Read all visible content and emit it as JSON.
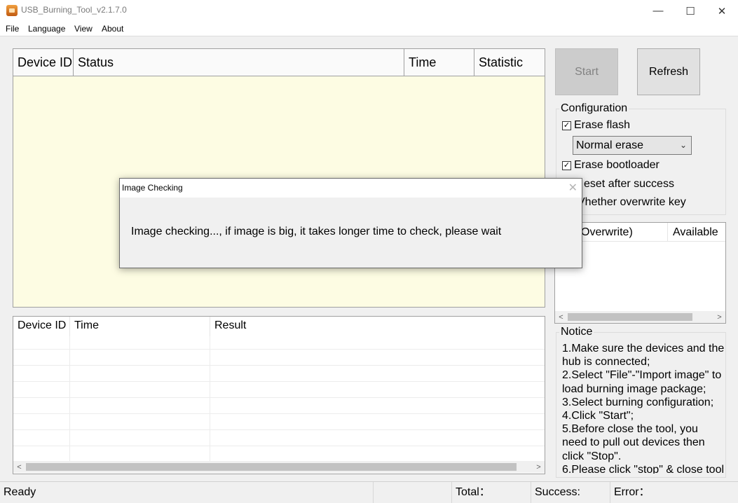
{
  "window": {
    "title": "USB_Burning_Tool_v2.1.7.0",
    "minimize_glyph": "—",
    "maximize_glyph": "☐",
    "close_glyph": "✕"
  },
  "menu": {
    "items": [
      "File",
      "Language",
      "View",
      "About"
    ]
  },
  "device_table": {
    "columns": [
      "Device ID",
      "Status",
      "Time",
      "Statistic"
    ],
    "background": "#fdfce3"
  },
  "result_table": {
    "columns": [
      "Device ID",
      "Time",
      "Result"
    ],
    "scroll_left": "<",
    "scroll_right": ">"
  },
  "buttons": {
    "start": "Start",
    "refresh": "Refresh"
  },
  "configuration": {
    "title": "Configuration",
    "erase_flash": {
      "label": "Erase flash",
      "checked": true
    },
    "erase_mode": "Normal erase",
    "erase_bootloader": {
      "label": "Erase bootloader",
      "checked": true
    },
    "reset_after_success": "eset after success",
    "overwrite_key": "Vhether overwrite key",
    "check_glyph": "✓"
  },
  "key_table": {
    "columns": [
      "Overwrite)",
      "Available"
    ],
    "scroll_left": "<",
    "scroll_right": ">"
  },
  "notice": {
    "title": "Notice",
    "text": "1.Make sure the devices and the hub is connected;\n2.Select \"File\"-\"Import image\" to load burning image package;\n3.Select burning configuration;\n4.Click \"Start\";\n5.Before close the tool, you need to pull out devices then click \"Stop\".\n6.Please click \"stop\" & close tool"
  },
  "statusbar": {
    "status": "Ready",
    "total": "Total：",
    "success": "Success:",
    "error": "Error："
  },
  "dialog": {
    "title": "Image Checking",
    "close_glyph": "✕",
    "message": "Image checking..., if image is big, it takes longer time to check, please wait"
  }
}
